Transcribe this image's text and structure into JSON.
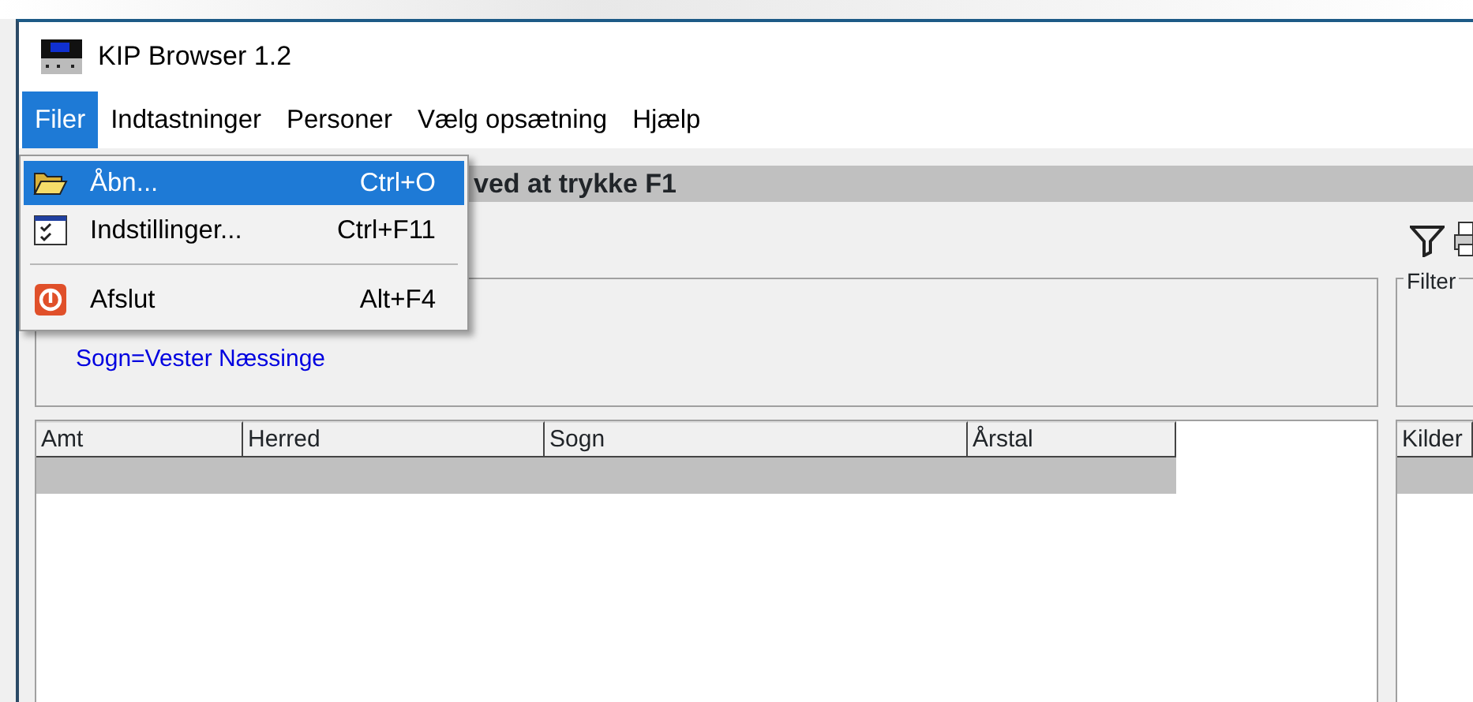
{
  "window": {
    "title": "KIP Browser 1.2"
  },
  "menu_bar": [
    {
      "label": "Filer",
      "selected": true
    },
    {
      "label": "Indtastninger",
      "selected": false
    },
    {
      "label": "Personer",
      "selected": false
    },
    {
      "label": "Vælg opsætning",
      "selected": false
    },
    {
      "label": "Hjælp",
      "selected": false
    }
  ],
  "file_menu": [
    {
      "kind": "item",
      "label": "Åbn...",
      "shortcut": "Ctrl+O",
      "selected": true
    },
    {
      "kind": "item",
      "label": "Indstillinger...",
      "shortcut": "Ctrl+F11",
      "selected": false
    },
    {
      "kind": "separator"
    },
    {
      "kind": "item",
      "label": "Afslut",
      "shortcut": "Alt+F4",
      "selected": false
    }
  ],
  "hint_bar": {
    "text": "ved at trykke F1"
  },
  "criteria": {
    "text": "Sogn=Vester Næssinge"
  },
  "filter_group": {
    "title": "Filter"
  },
  "table": {
    "columns": [
      "Amt",
      "Herred",
      "Sogn",
      "Årstal"
    ]
  },
  "sources_table": {
    "columns": [
      "Kilder"
    ]
  }
}
